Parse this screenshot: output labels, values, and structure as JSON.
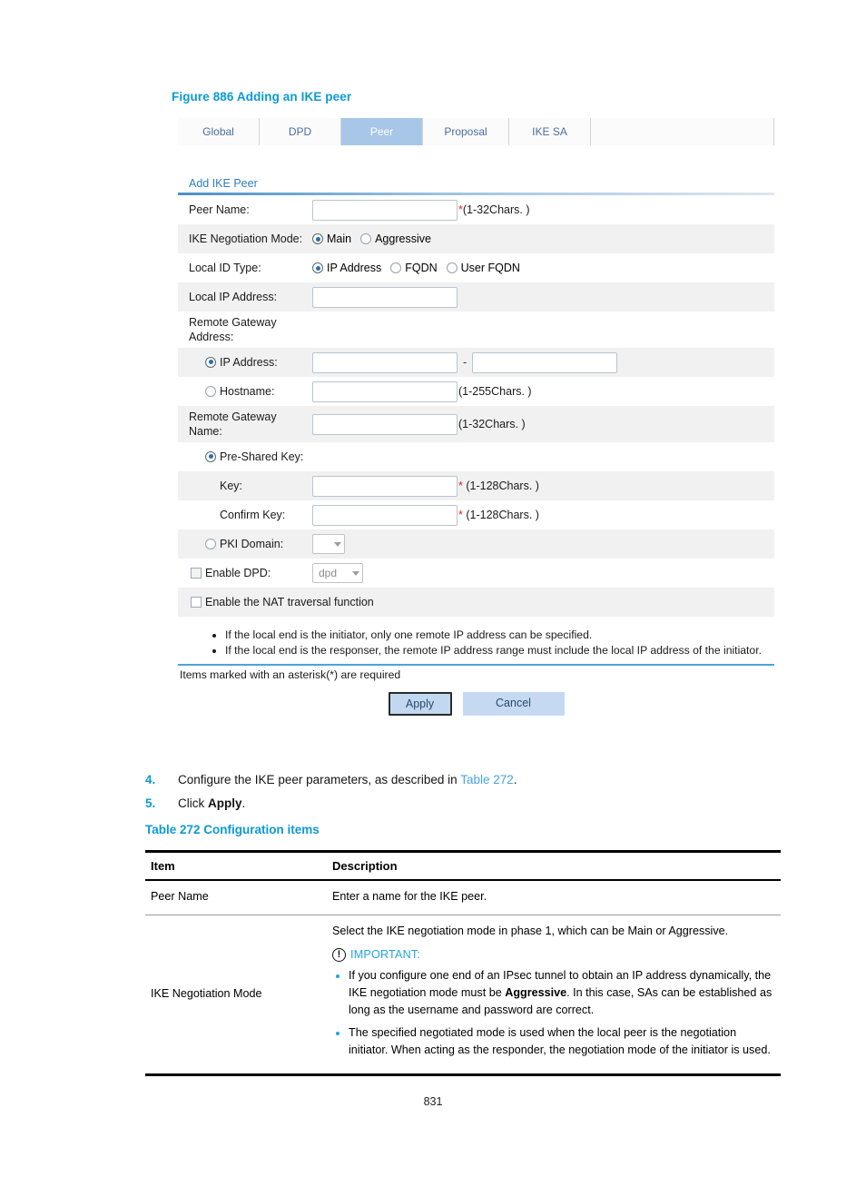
{
  "figure": {
    "caption": "Figure 886 Adding an IKE peer"
  },
  "screenshot": {
    "tabs": [
      {
        "label": "Global",
        "active": false
      },
      {
        "label": "DPD",
        "active": false
      },
      {
        "label": "Peer",
        "active": true
      },
      {
        "label": "Proposal",
        "active": false
      },
      {
        "label": "IKE SA",
        "active": false
      }
    ],
    "section_title": "Add IKE Peer",
    "fields": {
      "peer_name_label": "Peer Name:",
      "peer_name_value": "",
      "peer_name_required": "*",
      "peer_name_hint": "(1-32Chars. )",
      "ike_negotiation_mode_label": "IKE Negotiation Mode:",
      "ike_mode_options": [
        "Main",
        "Aggressive"
      ],
      "ike_mode_selected": "Main",
      "local_id_type_label": "Local ID Type:",
      "local_id_options": [
        "IP Address",
        "FQDN",
        "User FQDN"
      ],
      "local_id_selected": "IP Address",
      "local_ip_address_label": "Local IP Address:",
      "local_ip_address_value": "",
      "remote_gateway_address_label": "Remote Gateway Address:",
      "remote_ip_address_label": "IP Address:",
      "remote_ip_start_value": "",
      "remote_ip_end_value": "",
      "remote_ip_separator": "-",
      "hostname_label": "Hostname:",
      "hostname_value": "",
      "hostname_hint": "(1-255Chars. )",
      "remote_gateway_name_label": "Remote Gateway Name:",
      "remote_gateway_name_value": "",
      "remote_gateway_name_hint": "(1-32Chars. )",
      "pre_shared_key_label": "Pre-Shared Key:",
      "key_label": "Key:",
      "key_value": "",
      "key_required": "*",
      "key_hint": "(1-128Chars. )",
      "confirm_key_label": "Confirm Key:",
      "confirm_key_value": "",
      "confirm_key_required": "*",
      "confirm_key_hint": "(1-128Chars. )",
      "pki_domain_label": "PKI Domain:",
      "pki_domain_value": "",
      "enable_dpd_label": "Enable DPD:",
      "dpd_select_value": "dpd",
      "nat_traversal_label": "Enable the NAT traversal function"
    },
    "auth_selected": "Pre-Shared Key",
    "notes": [
      "If the local end is the initiator, only one remote IP address can be specified.",
      "If the local end is the responser, the remote IP address range must include the local IP address of the initiator."
    ],
    "asterisk_note": "Items marked with an asterisk(*) are required",
    "buttons": {
      "apply": "Apply",
      "cancel": "Cancel"
    }
  },
  "steps": [
    {
      "number": "4.",
      "text_before": "Configure the IKE peer parameters, as described in ",
      "link": "Table 272",
      "text_after": "."
    },
    {
      "number": "5.",
      "text_before": "Click ",
      "bold": "Apply",
      "text_after": "."
    }
  ],
  "table": {
    "caption": "Table 272 Configuration items",
    "headers": [
      "Item",
      "Description"
    ],
    "rows": [
      {
        "item": "Peer Name",
        "description": "Enter a name for the IKE peer."
      },
      {
        "item": "IKE Negotiation Mode",
        "description_intro": "Select the IKE negotiation mode in phase 1, which can be Main or Aggressive.",
        "important_label": "IMPORTANT:",
        "important_icon": "exclamation-circle-icon",
        "bullets": [
          {
            "part1": "If you configure one end of an IPsec tunnel to obtain an IP address dynamically, the IKE negotiation mode must be ",
            "bold": "Aggressive",
            "part2": ". In this case, SAs can be established as long as the username and password are correct."
          },
          {
            "part1": "The specified negotiated mode is used when the local peer is the negotiation initiator. When acting as the responder, the negotiation mode of the initiator is used.",
            "bold": "",
            "part2": ""
          }
        ]
      }
    ]
  },
  "footer": {
    "page_number": "831"
  },
  "colors": {
    "accent_blue": "#0b9ad6",
    "link_blue": "#4aa3dd",
    "tab_active_bg": "#a8c6e8",
    "important_blue": "#22a5e0",
    "required_red": "#e02020"
  }
}
